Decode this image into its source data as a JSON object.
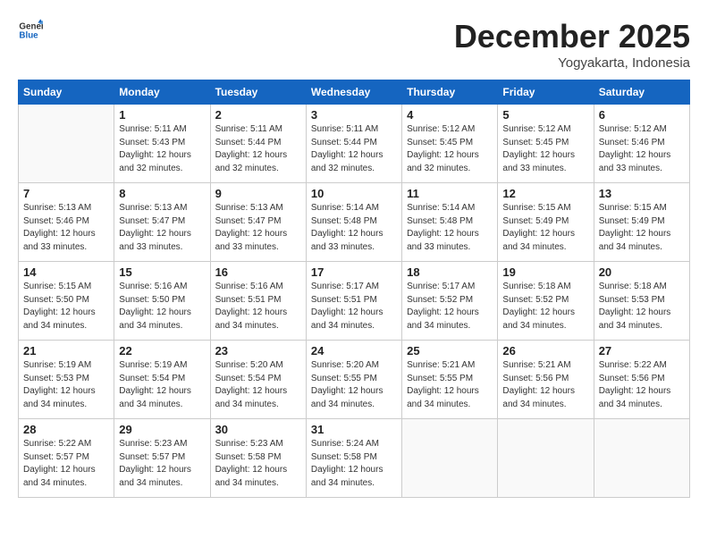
{
  "header": {
    "logo_line1": "General",
    "logo_line2": "Blue",
    "month": "December 2025",
    "location": "Yogyakarta, Indonesia"
  },
  "days_of_week": [
    "Sunday",
    "Monday",
    "Tuesday",
    "Wednesday",
    "Thursday",
    "Friday",
    "Saturday"
  ],
  "weeks": [
    [
      {
        "day": "",
        "info": ""
      },
      {
        "day": "1",
        "info": "Sunrise: 5:11 AM\nSunset: 5:43 PM\nDaylight: 12 hours\nand 32 minutes."
      },
      {
        "day": "2",
        "info": "Sunrise: 5:11 AM\nSunset: 5:44 PM\nDaylight: 12 hours\nand 32 minutes."
      },
      {
        "day": "3",
        "info": "Sunrise: 5:11 AM\nSunset: 5:44 PM\nDaylight: 12 hours\nand 32 minutes."
      },
      {
        "day": "4",
        "info": "Sunrise: 5:12 AM\nSunset: 5:45 PM\nDaylight: 12 hours\nand 32 minutes."
      },
      {
        "day": "5",
        "info": "Sunrise: 5:12 AM\nSunset: 5:45 PM\nDaylight: 12 hours\nand 33 minutes."
      },
      {
        "day": "6",
        "info": "Sunrise: 5:12 AM\nSunset: 5:46 PM\nDaylight: 12 hours\nand 33 minutes."
      }
    ],
    [
      {
        "day": "7",
        "info": "Sunrise: 5:13 AM\nSunset: 5:46 PM\nDaylight: 12 hours\nand 33 minutes."
      },
      {
        "day": "8",
        "info": "Sunrise: 5:13 AM\nSunset: 5:47 PM\nDaylight: 12 hours\nand 33 minutes."
      },
      {
        "day": "9",
        "info": "Sunrise: 5:13 AM\nSunset: 5:47 PM\nDaylight: 12 hours\nand 33 minutes."
      },
      {
        "day": "10",
        "info": "Sunrise: 5:14 AM\nSunset: 5:48 PM\nDaylight: 12 hours\nand 33 minutes."
      },
      {
        "day": "11",
        "info": "Sunrise: 5:14 AM\nSunset: 5:48 PM\nDaylight: 12 hours\nand 33 minutes."
      },
      {
        "day": "12",
        "info": "Sunrise: 5:15 AM\nSunset: 5:49 PM\nDaylight: 12 hours\nand 34 minutes."
      },
      {
        "day": "13",
        "info": "Sunrise: 5:15 AM\nSunset: 5:49 PM\nDaylight: 12 hours\nand 34 minutes."
      }
    ],
    [
      {
        "day": "14",
        "info": "Sunrise: 5:15 AM\nSunset: 5:50 PM\nDaylight: 12 hours\nand 34 minutes."
      },
      {
        "day": "15",
        "info": "Sunrise: 5:16 AM\nSunset: 5:50 PM\nDaylight: 12 hours\nand 34 minutes."
      },
      {
        "day": "16",
        "info": "Sunrise: 5:16 AM\nSunset: 5:51 PM\nDaylight: 12 hours\nand 34 minutes."
      },
      {
        "day": "17",
        "info": "Sunrise: 5:17 AM\nSunset: 5:51 PM\nDaylight: 12 hours\nand 34 minutes."
      },
      {
        "day": "18",
        "info": "Sunrise: 5:17 AM\nSunset: 5:52 PM\nDaylight: 12 hours\nand 34 minutes."
      },
      {
        "day": "19",
        "info": "Sunrise: 5:18 AM\nSunset: 5:52 PM\nDaylight: 12 hours\nand 34 minutes."
      },
      {
        "day": "20",
        "info": "Sunrise: 5:18 AM\nSunset: 5:53 PM\nDaylight: 12 hours\nand 34 minutes."
      }
    ],
    [
      {
        "day": "21",
        "info": "Sunrise: 5:19 AM\nSunset: 5:53 PM\nDaylight: 12 hours\nand 34 minutes."
      },
      {
        "day": "22",
        "info": "Sunrise: 5:19 AM\nSunset: 5:54 PM\nDaylight: 12 hours\nand 34 minutes."
      },
      {
        "day": "23",
        "info": "Sunrise: 5:20 AM\nSunset: 5:54 PM\nDaylight: 12 hours\nand 34 minutes."
      },
      {
        "day": "24",
        "info": "Sunrise: 5:20 AM\nSunset: 5:55 PM\nDaylight: 12 hours\nand 34 minutes."
      },
      {
        "day": "25",
        "info": "Sunrise: 5:21 AM\nSunset: 5:55 PM\nDaylight: 12 hours\nand 34 minutes."
      },
      {
        "day": "26",
        "info": "Sunrise: 5:21 AM\nSunset: 5:56 PM\nDaylight: 12 hours\nand 34 minutes."
      },
      {
        "day": "27",
        "info": "Sunrise: 5:22 AM\nSunset: 5:56 PM\nDaylight: 12 hours\nand 34 minutes."
      }
    ],
    [
      {
        "day": "28",
        "info": "Sunrise: 5:22 AM\nSunset: 5:57 PM\nDaylight: 12 hours\nand 34 minutes."
      },
      {
        "day": "29",
        "info": "Sunrise: 5:23 AM\nSunset: 5:57 PM\nDaylight: 12 hours\nand 34 minutes."
      },
      {
        "day": "30",
        "info": "Sunrise: 5:23 AM\nSunset: 5:58 PM\nDaylight: 12 hours\nand 34 minutes."
      },
      {
        "day": "31",
        "info": "Sunrise: 5:24 AM\nSunset: 5:58 PM\nDaylight: 12 hours\nand 34 minutes."
      },
      {
        "day": "",
        "info": ""
      },
      {
        "day": "",
        "info": ""
      },
      {
        "day": "",
        "info": ""
      }
    ]
  ]
}
